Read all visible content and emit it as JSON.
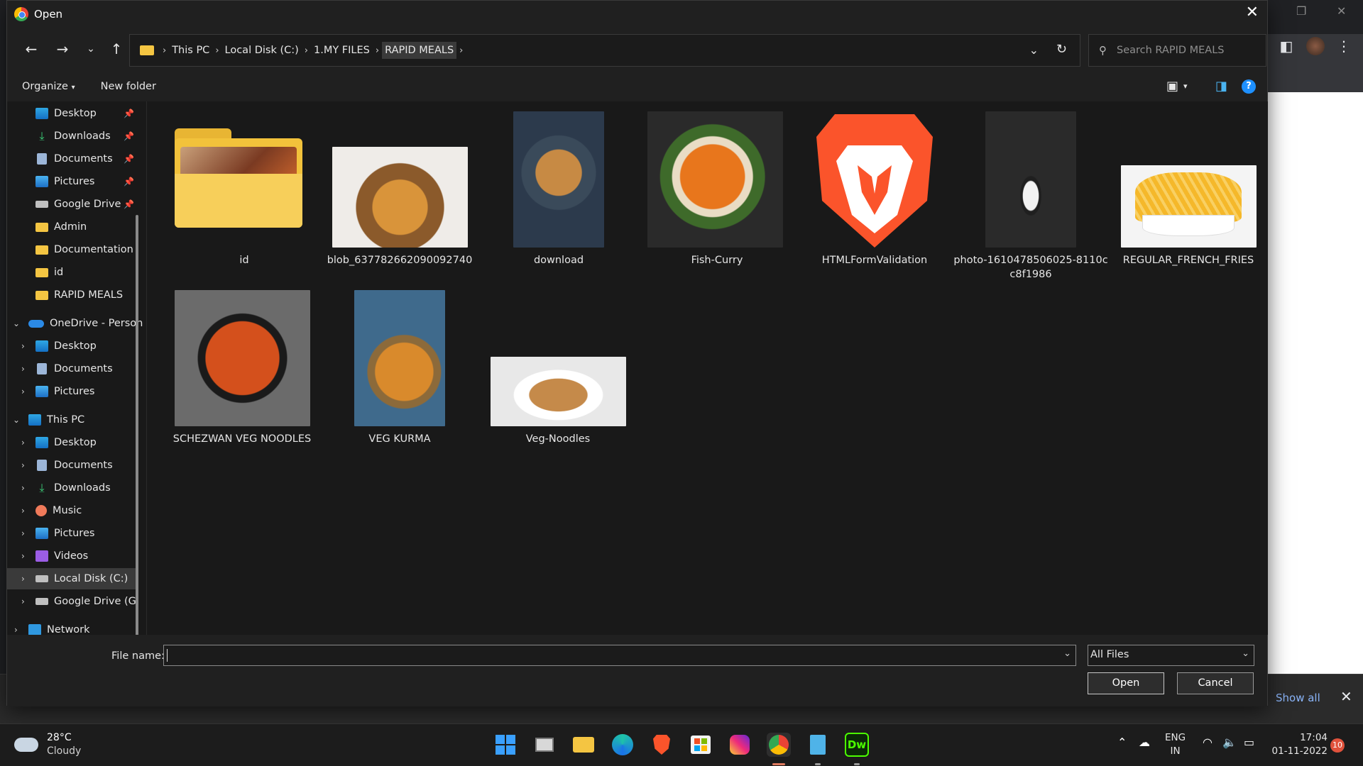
{
  "dialog": {
    "title": "Open",
    "address": {
      "crumbs": [
        "This PC",
        "Local Disk (C:)",
        "1.MY FILES",
        "RAPID MEALS"
      ]
    },
    "search": {
      "placeholder": "Search RAPID MEALS"
    },
    "commands": {
      "organize": "Organize",
      "new_folder": "New folder"
    },
    "sidebar": {
      "quick_access": [
        {
          "label": "Desktop",
          "icon": "desktop-icon",
          "pinned": true
        },
        {
          "label": "Downloads",
          "icon": "download-icon",
          "pinned": true
        },
        {
          "label": "Documents",
          "icon": "document-icon",
          "pinned": true
        },
        {
          "label": "Pictures",
          "icon": "pictures-icon",
          "pinned": true
        },
        {
          "label": "Google Drive",
          "icon": "drive-icon",
          "pinned": true
        },
        {
          "label": "Admin",
          "icon": "folder-icon",
          "pinned": false
        },
        {
          "label": "Documentation",
          "icon": "folder-icon",
          "pinned": false
        },
        {
          "label": "id",
          "icon": "folder-icon",
          "pinned": false
        },
        {
          "label": "RAPID MEALS",
          "icon": "folder-icon",
          "pinned": false
        }
      ],
      "onedrive": {
        "label": "OneDrive - Person",
        "items": [
          "Desktop",
          "Documents",
          "Pictures"
        ]
      },
      "this_pc": {
        "label": "This PC",
        "items": [
          "Desktop",
          "Documents",
          "Downloads",
          "Music",
          "Pictures",
          "Videos",
          "Local Disk (C:)",
          "Google Drive (G"
        ]
      },
      "network": "Network"
    },
    "files": [
      {
        "name": "id",
        "type": "folder"
      },
      {
        "name": "blob_637782662090092740",
        "type": "image"
      },
      {
        "name": "download",
        "type": "image"
      },
      {
        "name": "Fish-Curry",
        "type": "image"
      },
      {
        "name": "HTMLFormValidation",
        "type": "brave-shortcut"
      },
      {
        "name": "photo-1610478506025-8110c c8f1986",
        "type": "image"
      },
      {
        "name": "REGULAR_FRENCH_FRIES",
        "type": "image"
      },
      {
        "name": "SCHEZWAN VEG NOODLES",
        "type": "image"
      },
      {
        "name": "VEG KURMA",
        "type": "image"
      },
      {
        "name": "Veg-Noodles",
        "type": "image"
      }
    ],
    "bottom": {
      "file_name_label": "File name:",
      "file_name_value": "",
      "file_type": "All Files",
      "open_label": "Open",
      "cancel_label": "Cancel"
    }
  },
  "browser_bg": {
    "show_all": "Show all"
  },
  "taskbar": {
    "weather": {
      "temp": "28°C",
      "condition": "Cloudy"
    },
    "lang": {
      "line1": "ENG",
      "line2": "IN"
    },
    "clock": {
      "time": "17:04",
      "date": "01-11-2022"
    },
    "notifications": "10",
    "apps": [
      "start-icon",
      "task-view-icon",
      "file-explorer-icon",
      "edge-icon",
      "brave-icon",
      "store-icon",
      "instagram-icon",
      "chrome-icon",
      "notepad-icon",
      "dreamweaver-icon"
    ],
    "dw_label": "Dw"
  },
  "colors": {
    "accent": "#1e90ff",
    "folder": "#f4c542",
    "brave": "#fb542b"
  }
}
